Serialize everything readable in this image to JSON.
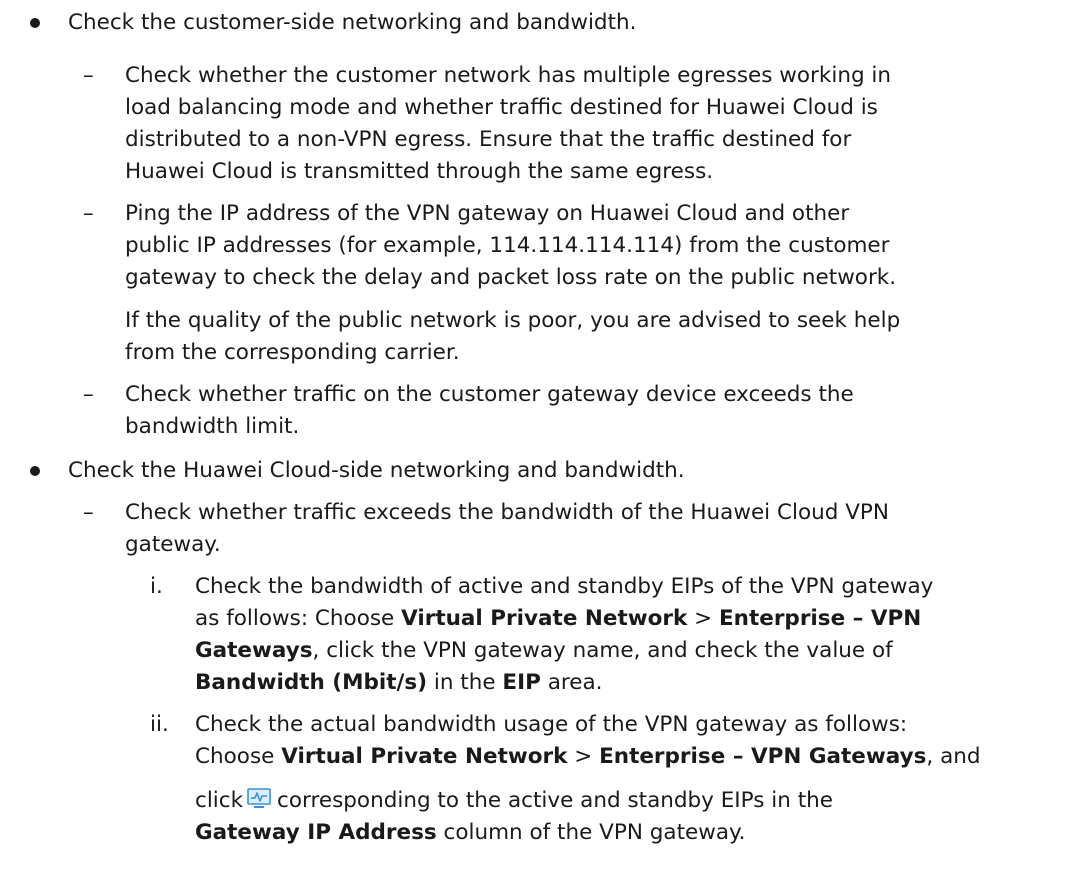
{
  "items": [
    {
      "text": "Check the customer-side networking and bandwidth.",
      "subitems": [
        {
          "marker": "–",
          "lines": [
            "Check whether the customer network has multiple egresses working in",
            "load balancing mode and whether traffic destined for Huawei Cloud is",
            "distributed to a non-VPN egress. Ensure that the traffic destined for",
            "Huawei Cloud is transmitted through the same egress."
          ]
        },
        {
          "marker": "–",
          "lines": [
            "Ping the IP address of the VPN gateway on Huawei Cloud and other",
            "public IP addresses (for example, 114.114.114.114) from the customer",
            "gateway to check the delay and packet loss rate on the public network."
          ],
          "note_lines": [
            "If the quality of the public network is poor, you are advised to seek help",
            "from the corresponding carrier."
          ]
        },
        {
          "marker": "–",
          "lines": [
            "Check whether traffic on the customer gateway device exceeds the",
            "bandwidth limit."
          ]
        }
      ]
    },
    {
      "text": "Check the Huawei Cloud-side networking and bandwidth.",
      "subitems": [
        {
          "marker": "–",
          "lines": [
            "Check whether traffic exceeds the bandwidth of the Huawei Cloud VPN",
            "gateway."
          ],
          "steps": [
            {
              "marker": "i.",
              "l1": "Check the bandwidth of active and standby EIPs of the VPN gateway",
              "l2_a": "as follows: Choose ",
              "l2_b": "Virtual Private Network",
              "l2_c": " > ",
              "l2_d": "Enterprise – VPN",
              "l3_a": "Gateways",
              "l3_b": ", click the VPN gateway name, and check the value of",
              "l4_a": "Bandwidth (Mbit/s)",
              "l4_b": " in the ",
              "l4_c": "EIP",
              "l4_d": " area."
            },
            {
              "marker": "ii.",
              "l1": "Check the actual bandwidth usage of the VPN gateway as follows:",
              "l2_a": "Choose ",
              "l2_b": "Virtual Private Network",
              "l2_c": " > ",
              "l2_d": "Enterprise – VPN Gateways",
              "l2_e": ", and",
              "l3_a": "click",
              "l3_icon": "monitoring-chart-icon",
              "l3_b": "corresponding to the active and standby EIPs in the",
              "l4_a": "Gateway IP Address",
              "l4_b": " column of the VPN gateway."
            }
          ]
        }
      ]
    }
  ]
}
